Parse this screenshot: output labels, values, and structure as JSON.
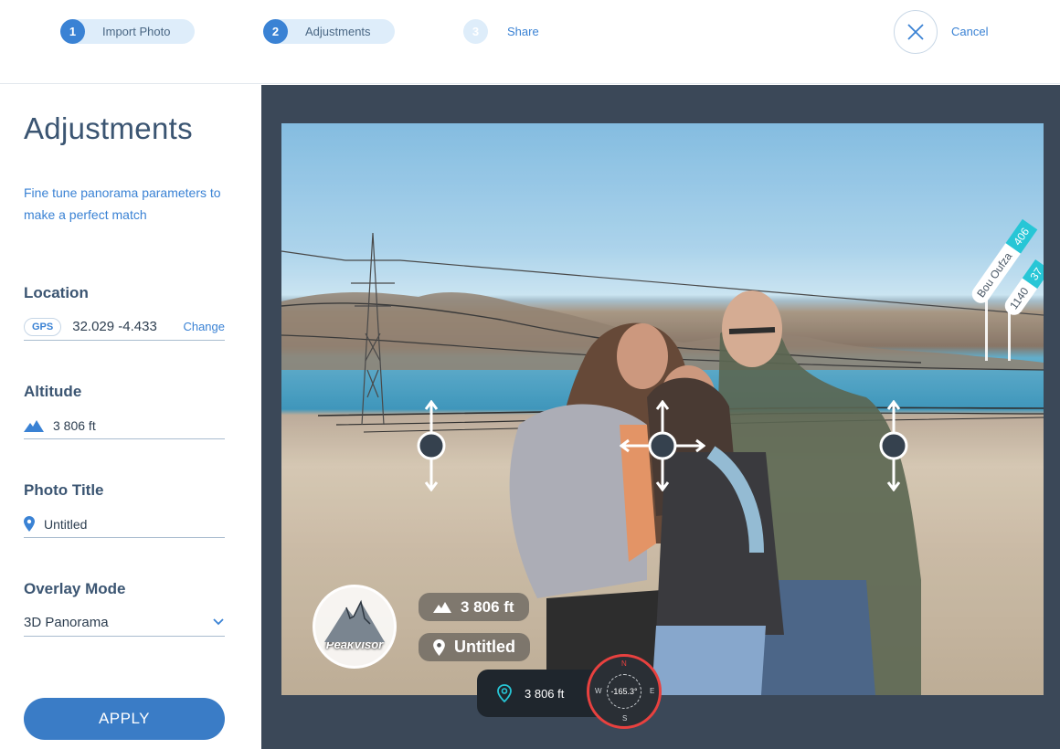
{
  "stepper": {
    "steps": [
      {
        "num": "1",
        "label": "Import Photo"
      },
      {
        "num": "2",
        "label": "Adjustments"
      },
      {
        "num": "3",
        "label": "Share"
      }
    ],
    "cancel_label": "Cancel",
    "cancel_icon": "close-icon"
  },
  "sidebar": {
    "title": "Adjustments",
    "description": "Fine tune panorama parameters to make a perfect match",
    "location": {
      "label": "Location",
      "badge": "GPS",
      "coords": "32.029 -4.433",
      "change_label": "Change"
    },
    "altitude": {
      "label": "Altitude",
      "value": "3 806 ft",
      "icon": "mountain-icon"
    },
    "photo_title": {
      "label": "Photo Title",
      "value": "Untitled",
      "icon": "pin-icon"
    },
    "overlay_mode": {
      "label": "Overlay Mode",
      "value": "3D Panorama",
      "icon": "chevron-down-icon"
    },
    "apply_label": "APPLY"
  },
  "photo": {
    "peaks": [
      {
        "name": "Bou Oufza",
        "alt": "406"
      },
      {
        "name": "1140",
        "alt": "37"
      }
    ],
    "brand": "PeakVisor",
    "altitude_pill": "3 806 ft",
    "title_pill": "Untitled",
    "location_pill": "3 806 ft",
    "compass": {
      "n": "N",
      "s": "S",
      "e": "E",
      "w": "W",
      "reading": "-165.3°"
    }
  },
  "colors": {
    "accent": "#3a82d4",
    "workspace": "#3b4858",
    "peak_tag": "#27c6d6",
    "compass_ring": "#e8413f"
  }
}
